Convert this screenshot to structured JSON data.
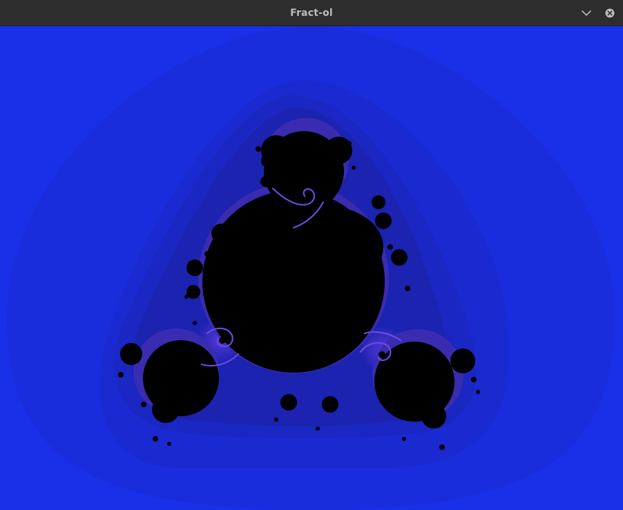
{
  "window": {
    "title": "Fract-ol"
  },
  "titlebar": {
    "menu_icon": "chevron-down-icon",
    "close_icon": "close-icon"
  },
  "fractal": {
    "type": "julia",
    "colors": {
      "outer": "#1a2fe8",
      "band1": "#1a2ddc",
      "band2": "#1a2acc",
      "band3": "#1a27bc",
      "band4": "#1b22a8",
      "band5": "#22208c",
      "edge": "#4a34c8",
      "set": "#000000"
    }
  }
}
